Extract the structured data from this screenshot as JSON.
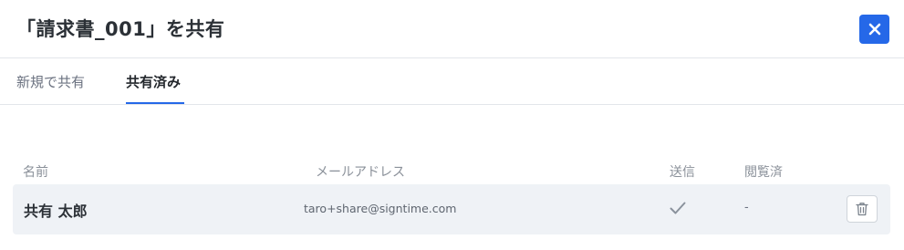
{
  "dialog": {
    "title": "「請求書_001」を共有",
    "close_icon": "close-icon"
  },
  "tabs": [
    {
      "label": "新規で共有",
      "active": false
    },
    {
      "label": "共有済み",
      "active": true
    }
  ],
  "table": {
    "headers": {
      "name": "名前",
      "email": "メールアドレス",
      "sent": "送信",
      "viewed": "閲覧済"
    },
    "rows": [
      {
        "name": "共有 太郎",
        "email": "taro+share@signtime.com",
        "sent_icon": "checkmark-icon",
        "viewed": "-",
        "delete_icon": "trash-icon"
      }
    ]
  },
  "colors": {
    "accent": "#2568e8",
    "row_background": "#eff2f6"
  }
}
